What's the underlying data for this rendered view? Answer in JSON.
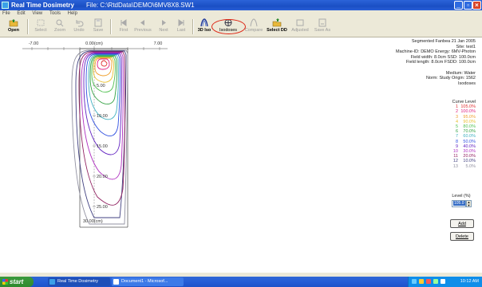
{
  "window": {
    "app_title": "Real Time Dosimetry",
    "file_label": "File: C:\\RtdData\\DEMO\\6MV8X8.SW1",
    "controls": [
      "minimize-icon",
      "maximize-icon",
      "close-icon"
    ]
  },
  "menu": [
    "File",
    "Edit",
    "View",
    "Tools",
    "Help"
  ],
  "toolbar": [
    {
      "label": "Open",
      "icon": "open-folder-icon",
      "enabled": true
    },
    {
      "label": "Select",
      "icon": "select-icon",
      "enabled": false
    },
    {
      "label": "Zoom",
      "icon": "zoom-icon",
      "enabled": false
    },
    {
      "label": "Undo",
      "icon": "undo-icon",
      "enabled": false
    },
    {
      "label": "Save",
      "icon": "save-icon",
      "enabled": false
    },
    {
      "label": "First",
      "icon": "first-icon",
      "enabled": false
    },
    {
      "label": "Previous",
      "icon": "previous-icon",
      "enabled": false
    },
    {
      "label": "Next",
      "icon": "next-icon",
      "enabled": false
    },
    {
      "label": "Last",
      "icon": "last-icon",
      "enabled": false
    },
    {
      "label": "3D Iso",
      "icon": "3d-iso-icon",
      "enabled": true
    },
    {
      "label": "Isodoses",
      "icon": "isodoses-icon",
      "enabled": true
    },
    {
      "label": "Compare",
      "icon": "compare-icon",
      "enabled": false
    },
    {
      "label": "Select DD",
      "icon": "select-dd-icon",
      "enabled": true
    },
    {
      "label": "Adjusted",
      "icon": "adjusted-icon",
      "enabled": false
    },
    {
      "label": "Save As",
      "icon": "save-as-icon",
      "enabled": false
    }
  ],
  "plot": {
    "x_ticks": [
      "-7.00",
      "0.00(cm)",
      "7.00"
    ],
    "depth_labels": [
      "5.00",
      "10.00",
      "15.00",
      "20.00",
      "25.00",
      "30.00(cm)"
    ]
  },
  "info": {
    "lines": [
      "Segmented Fanbea  21 Jan 2005",
      "Site: test1",
      "Machine-ID: DEMO    Energy: 6MV-Photon",
      "Field width: 8.0cm      SSD: 100.0cm",
      "Field length: 8.0cm   FSDD: 100.0cm",
      "",
      "Medium: Water",
      "Norm: Study Origin: 1562",
      "Isodoses"
    ]
  },
  "legend": {
    "header": "Curve  Level",
    "curves": [
      {
        "curve": "1",
        "level": "105.0%",
        "color": "#e03030"
      },
      {
        "curve": "2",
        "level": "100.0%",
        "color": "#e02080"
      },
      {
        "curve": "3",
        "level": "95.0%",
        "color": "#f0a030"
      },
      {
        "curve": "4",
        "level": "90.0%",
        "color": "#e8c030"
      },
      {
        "curve": "5",
        "level": "80.0%",
        "color": "#50c050"
      },
      {
        "curve": "6",
        "level": "70.0%",
        "color": "#30a040"
      },
      {
        "curve": "7",
        "level": "60.0%",
        "color": "#40b0c0"
      },
      {
        "curve": "8",
        "level": "50.0%",
        "color": "#3050e0"
      },
      {
        "curve": "9",
        "level": "40.0%",
        "color": "#6020c0"
      },
      {
        "curve": "10",
        "level": "30.0%",
        "color": "#b030c0"
      },
      {
        "curve": "11",
        "level": "20.0%",
        "color": "#902060"
      },
      {
        "curve": "12",
        "level": "10.0%",
        "color": "#404080"
      },
      {
        "curve": "13",
        "level": "5.0%",
        "color": "#9090a0"
      }
    ]
  },
  "level_panel": {
    "label": "Level (%)",
    "value": "105.0",
    "add_label": "Add",
    "delete_label": "Delete"
  },
  "taskbar": {
    "start": "start",
    "tasks": [
      "Real Time Dosimetry",
      "Document1 - Microsof..."
    ],
    "clock": "10:12 AM"
  }
}
